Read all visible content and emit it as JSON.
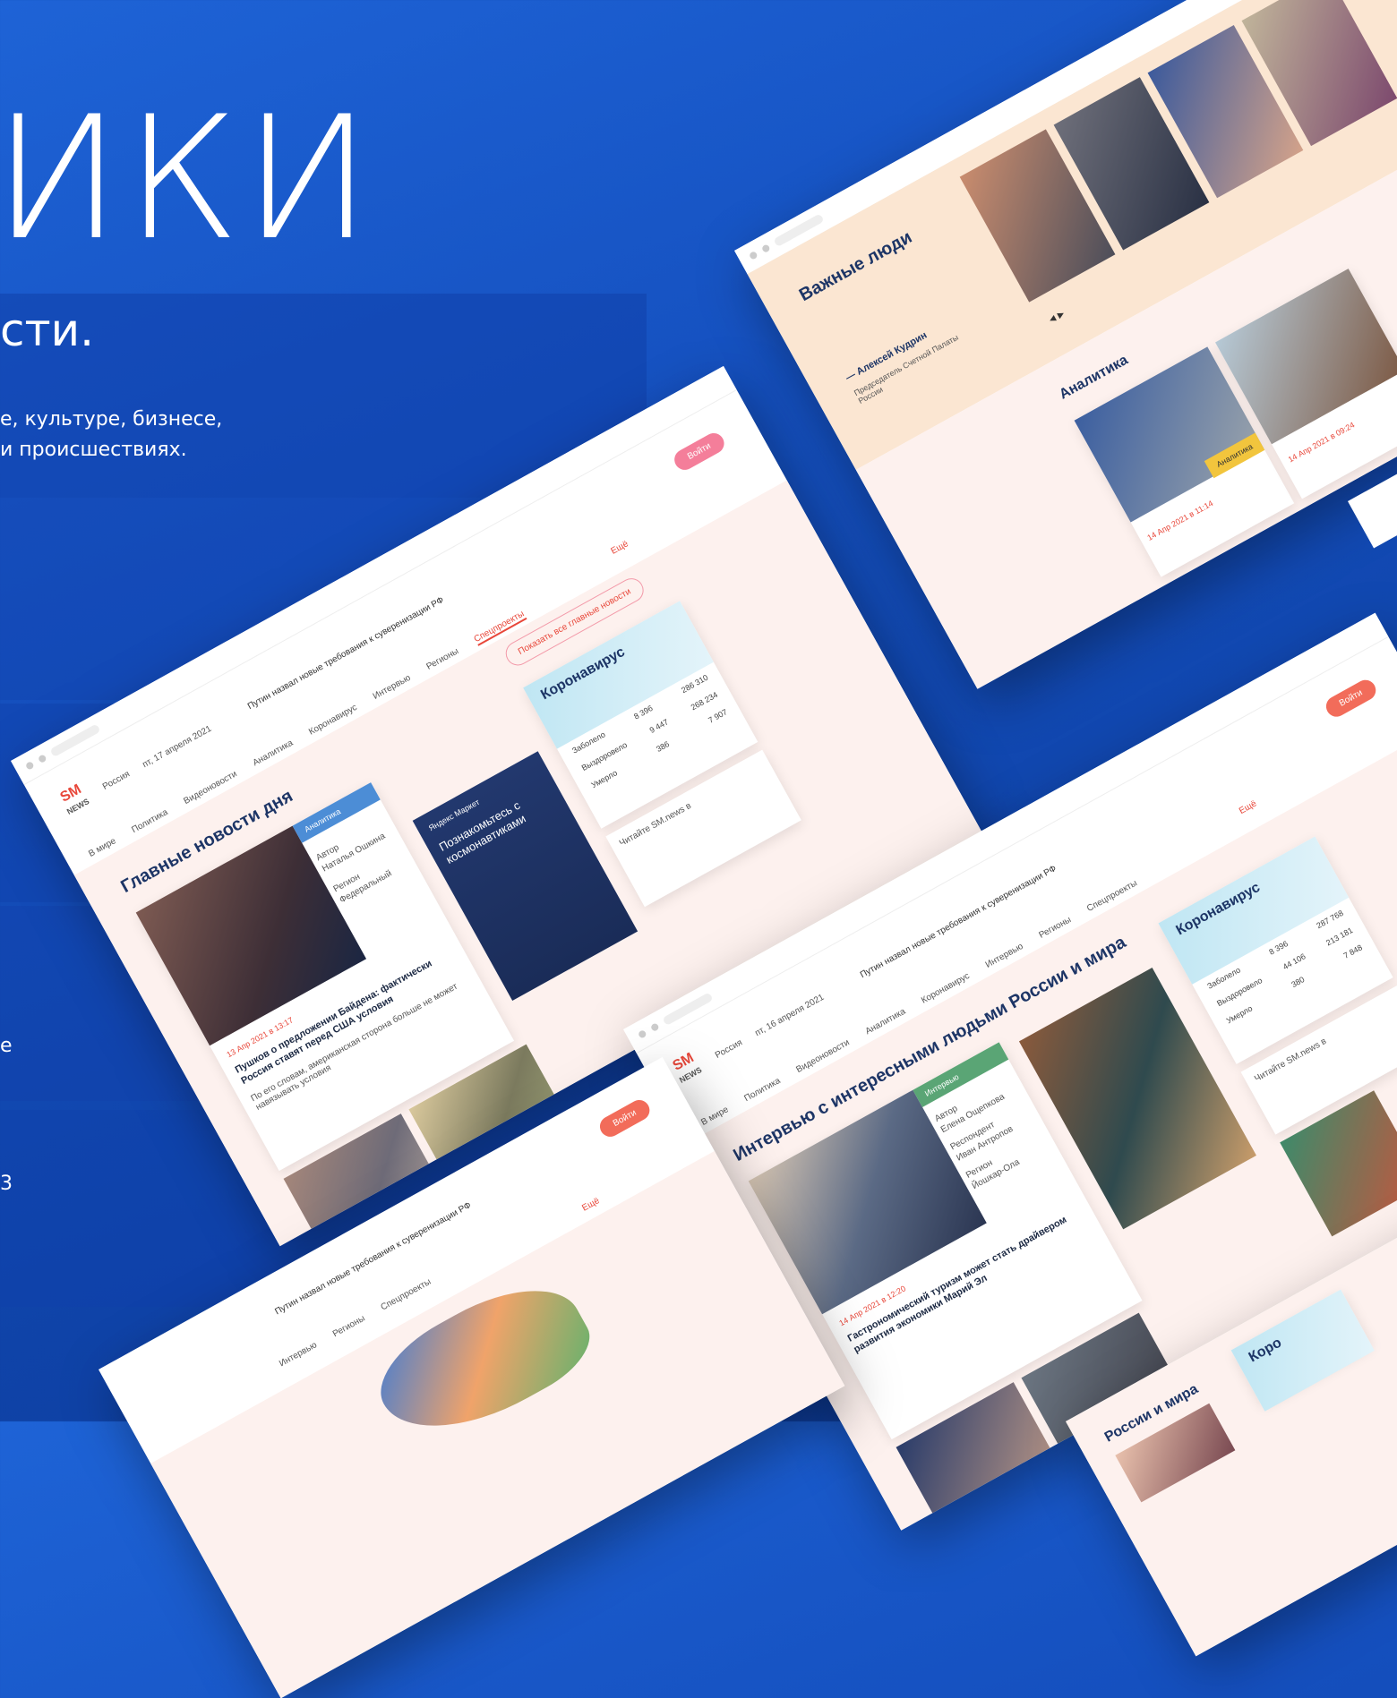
{
  "hero": {
    "title": "ИКИ",
    "subtitle": "сти.",
    "desc_line1": "е, культуре, бизнесе,",
    "desc_line2": "и происшествиях.",
    "frag1": "е",
    "frag2": "3"
  },
  "shot_main": {
    "date": "пт, 17 апреля 2021",
    "location": "Россия",
    "login": "Войти",
    "nav": [
      "В мире",
      "Политика",
      "Видеоновости",
      "Аналитика",
      "Коронавирус",
      "Интервью",
      "Регионы",
      "Спецпроекты"
    ],
    "ticker": "Путин назвал новые требования к суверенизации РФ",
    "section_title": "Главные новости дня",
    "tag": "Аналитика",
    "author_label": "Автор",
    "author": "Наталья Ошкина",
    "region_label": "Регион",
    "region": "Федеральный",
    "news_date": "13 Апр 2021 в 13:17",
    "headline": "Пушков о предложении Байдена: фактически Россия ставят перед США условия",
    "lead": "По его словам, американская сторона больше не может навязывать условия",
    "show_all": "Показать все главные новости",
    "more": "Ещё",
    "covid_title": "Коронавирус",
    "covid_rows": [
      [
        "Заболело",
        "8 396",
        "286 310"
      ],
      [
        "Выздоровело",
        "9 447",
        "268 234"
      ],
      [
        "Умерло",
        "386",
        "7 907"
      ]
    ],
    "ad_title": "Познакомьтесь с космонавтиками",
    "ad_brand": "Яндекс Маркет",
    "read_on": "Читайте SM.news в"
  },
  "shot_people": {
    "section_title": "Важные люди",
    "person_name": "— Алексей Кудрин",
    "person_role": "Председатель Счетной Палаты России",
    "analytics_title": "Аналитика",
    "date1": "14 Апр 2021 в 11:14",
    "date2": "14 Апр 2021 в 09:24",
    "tag": "Аналитика"
  },
  "shot_interview": {
    "date": "пт, 16 апреля 2021",
    "location": "Россия",
    "login": "Войти",
    "nav": [
      "В мире",
      "Политика",
      "Видеоновости",
      "Аналитика",
      "Коронавирус",
      "Интервью",
      "Регионы",
      "Спецпроекты"
    ],
    "ticker": "Путин назвал новые требования к суверенизации РФ",
    "section_title": "Интервью с интересными людьми России и мира",
    "tag": "Интервью",
    "author_label": "Автор",
    "author": "Елена Ощепкова",
    "resp_label": "Респондент",
    "resp": "Иван Антропов",
    "region_label": "Регион",
    "region": "Йошкар-Ола",
    "news_date": "14 Апр 2021 в 12:20",
    "headline": "Гастрономический туризм может стать драйвером развития экономики Марий Эл",
    "more": "Ещё",
    "covid_title": "Коронавирус",
    "covid_rows": [
      [
        "Заболело",
        "8 396",
        "287 768"
      ],
      [
        "Выздоровело",
        "44 106",
        "213 181"
      ],
      [
        "Умерло",
        "380",
        "7 848"
      ]
    ],
    "read_on": "Читайте SM.news в"
  },
  "shot_regions": {
    "login": "Войти",
    "nav": [
      "Интервью",
      "Регионы",
      "Спецпроекты"
    ],
    "ticker": "Путин назвал новые требования к суверенизации РФ",
    "more": "Ещё"
  },
  "shot_corner": {
    "title": "России и мира",
    "covid_title": "Коро"
  }
}
